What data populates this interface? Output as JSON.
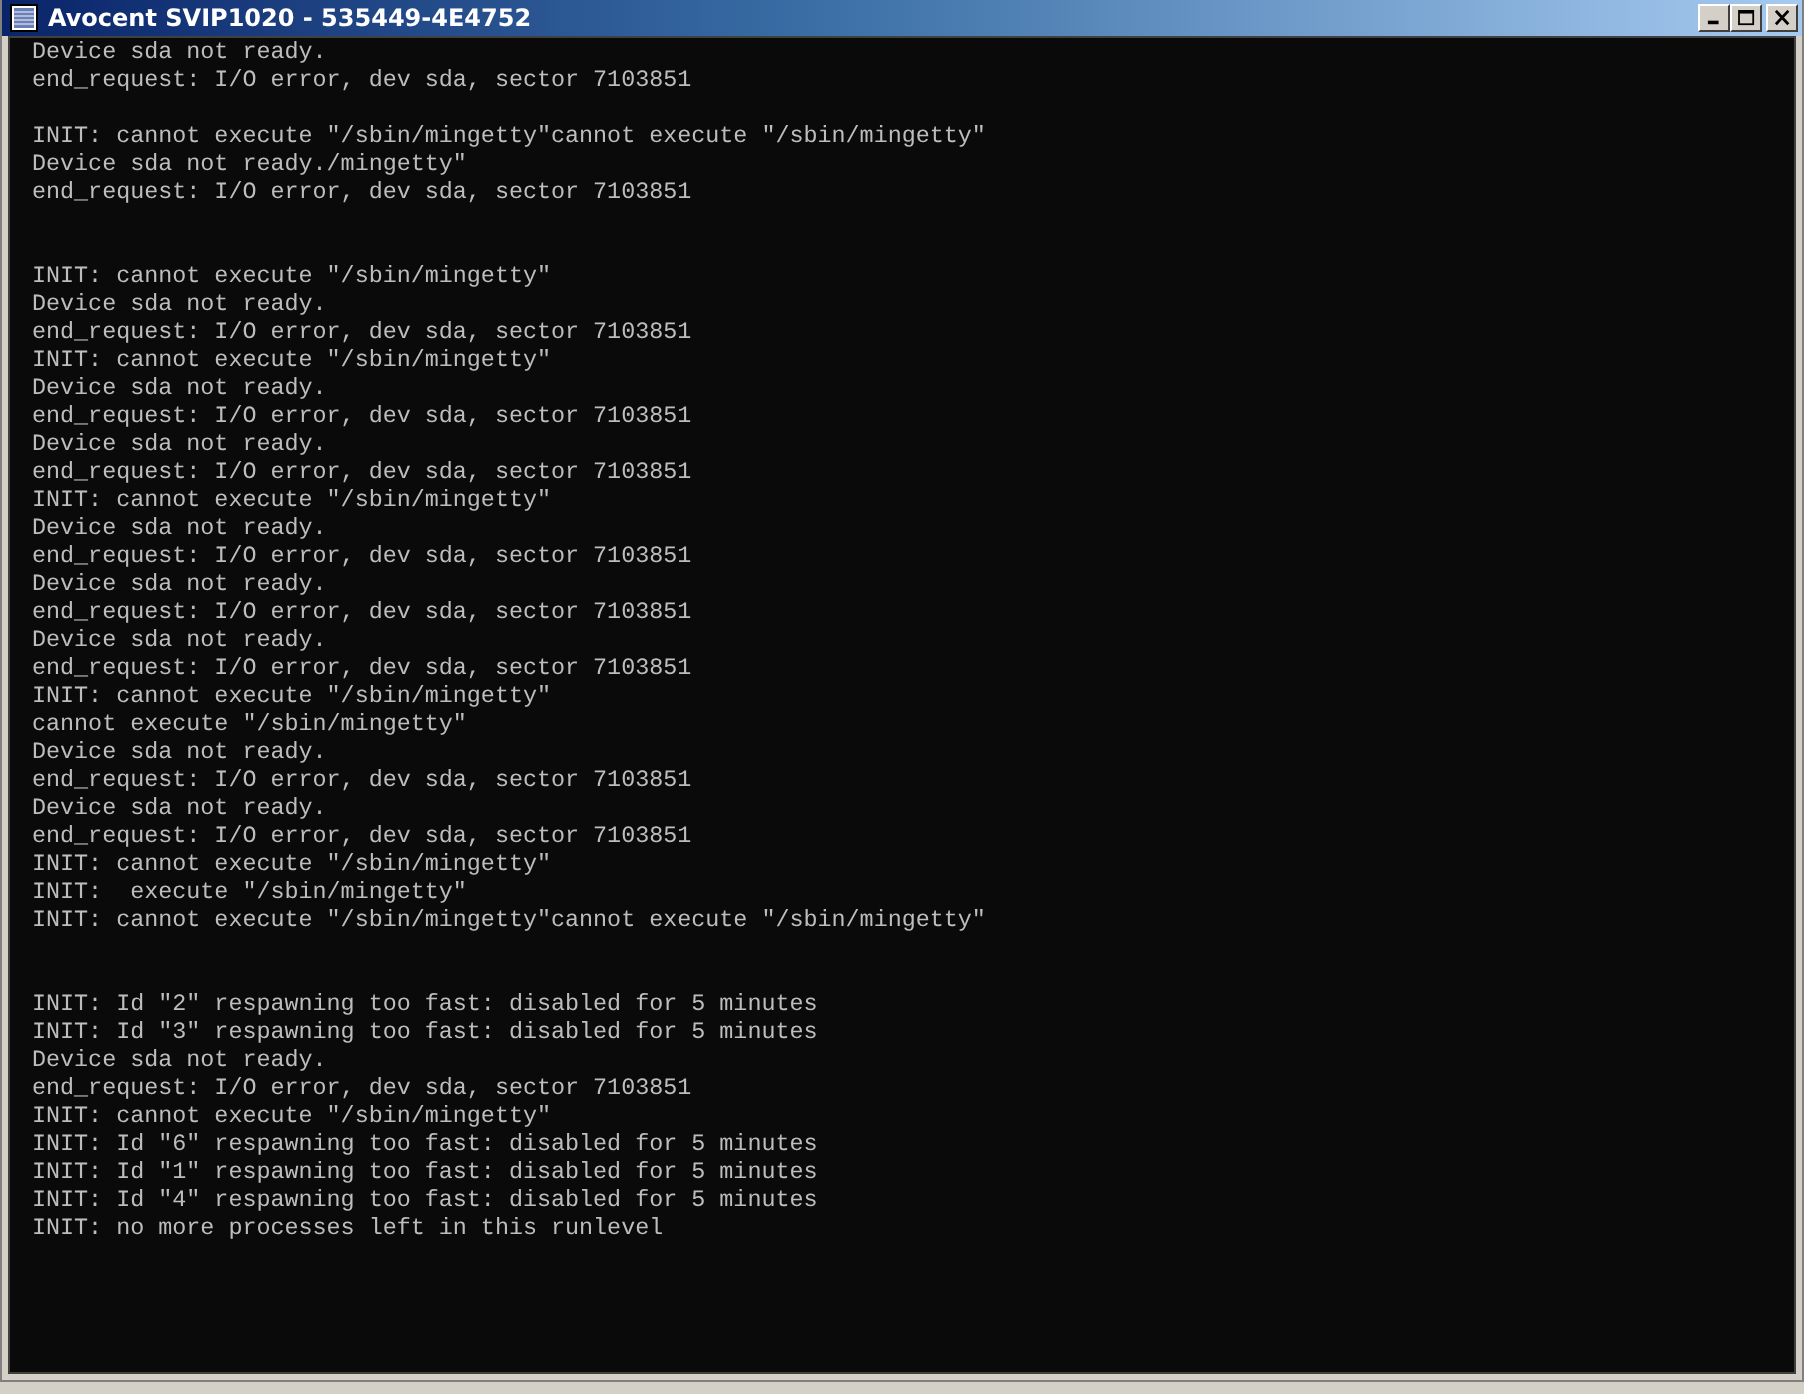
{
  "window": {
    "title": "Avocent SVIP1020 - 535449-4E4752"
  },
  "console": {
    "blocks": [
      {
        "lines": [
          "Device sda not ready.",
          "end_request: I/O error, dev sda, sector 7103851"
        ]
      },
      {
        "lines": [
          "INIT: cannot execute \"/sbin/mingetty\"cannot execute \"/sbin/mingetty\"",
          "Device sda not ready./mingetty\"",
          "end_request: I/O error, dev sda, sector 7103851"
        ]
      },
      {
        "lines": [
          "INIT: cannot execute \"/sbin/mingetty\"",
          "Device sda not ready.",
          "end_request: I/O error, dev sda, sector 7103851",
          "INIT: cannot execute \"/sbin/mingetty\"",
          "Device sda not ready.",
          "end_request: I/O error, dev sda, sector 7103851",
          "Device sda not ready.",
          "end_request: I/O error, dev sda, sector 7103851",
          "INIT: cannot execute \"/sbin/mingetty\"",
          "Device sda not ready.",
          "end_request: I/O error, dev sda, sector 7103851",
          "Device sda not ready.",
          "end_request: I/O error, dev sda, sector 7103851",
          "Device sda not ready.",
          "end_request: I/O error, dev sda, sector 7103851",
          "INIT: cannot execute \"/sbin/mingetty\"",
          "cannot execute \"/sbin/mingetty\"",
          "Device sda not ready.",
          "end_request: I/O error, dev sda, sector 7103851",
          "Device sda not ready.",
          "end_request: I/O error, dev sda, sector 7103851",
          "INIT: cannot execute \"/sbin/mingetty\"",
          "INIT:  execute \"/sbin/mingetty\"",
          "INIT: cannot execute \"/sbin/mingetty\"cannot execute \"/sbin/mingetty\""
        ]
      },
      {
        "lines": [
          "INIT: Id \"2\" respawning too fast: disabled for 5 minutes",
          "INIT: Id \"3\" respawning too fast: disabled for 5 minutes",
          "Device sda not ready.",
          "end_request: I/O error, dev sda, sector 7103851",
          "INIT: cannot execute \"/sbin/mingetty\"",
          "INIT: Id \"6\" respawning too fast: disabled for 5 minutes",
          "INIT: Id \"1\" respawning too fast: disabled for 5 minutes",
          "INIT: Id \"4\" respawning too fast: disabled for 5 minutes",
          "INIT: no more processes left in this runlevel"
        ]
      }
    ]
  }
}
